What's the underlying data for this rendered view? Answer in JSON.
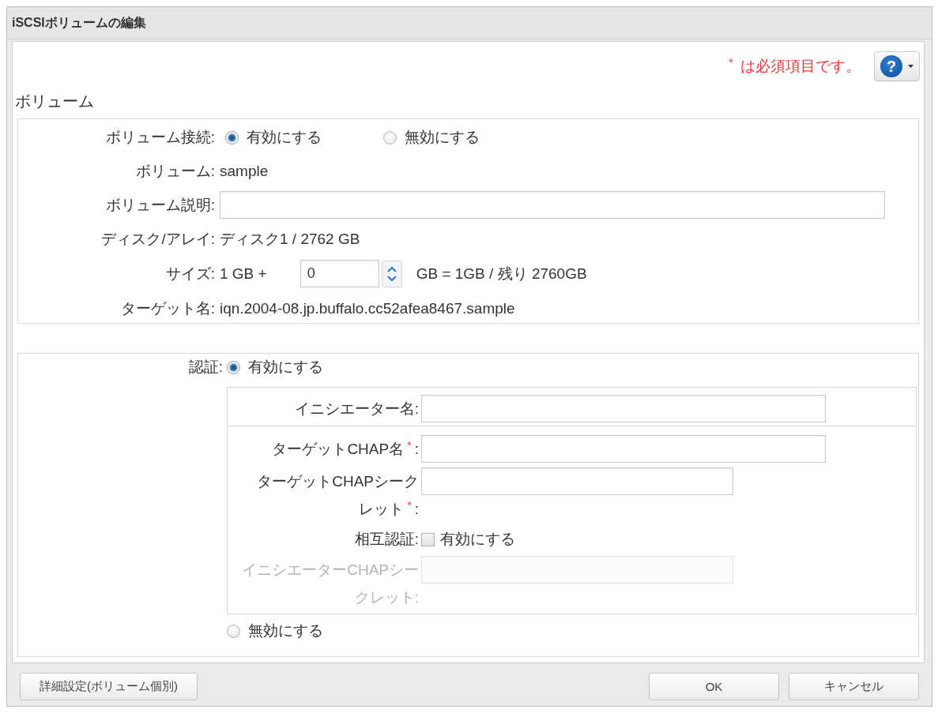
{
  "window": {
    "title": "iSCSIボリュームの編集"
  },
  "header": {
    "required_note": "$^{*}$ は必須項目です。",
    "help_button": {
      "symbol": "?"
    }
  },
  "volume": {
    "heading": "ボリューム",
    "rows": [
      {
        "kind": "radio",
        "label": "ボリューム接続:",
        "options": [
          {
            "label": "有効にする",
            "selected": true
          },
          {
            "label": "無効にする",
            "selected": false
          }
        ]
      },
      {
        "kind": "value",
        "label": "ボリューム:",
        "value": "sample"
      },
      {
        "kind": "input",
        "label": "ボリューム説明:"
      },
      {
        "kind": "value",
        "label": "ディスク/アレイ:",
        "value": "ディスク1 / 2762 GB"
      },
      {
        "kind": "size",
        "label": "サイズ:",
        "prefix": "1 GB +",
        "value": "0",
        "suffix": "GB = 1GB / 残り 2760GB"
      },
      {
        "kind": "value",
        "label": "ターゲット名:",
        "value": "iqn.2004-08.jp.buffalo.cc52afea8467.sample"
      }
    ]
  },
  "authentication": {
    "label": "認証:",
    "options": [
      {
        "label": "有効にする",
        "selected": true,
        "groups": [
          {
            "fields": [
              {
                "kind": "text",
                "label": "イニシエーター名:",
                "disabled": false
              }
            ]
          },
          {
            "fields": [
              {
                "kind": "text",
                "label": "ターゲットCHAP名$^{*}$:",
                "disabled": false
              },
              {
                "kind": "password",
                "label": "ターゲットCHAPシークレット$^{*}$:",
                "disabled": false
              },
              {
                "kind": "checkbox",
                "label": "相互認証:",
                "option": "有効にする",
                "checked": false,
                "disabled": false
              },
              {
                "kind": "password",
                "label": "イニシエーターCHAPシークレット:",
                "disabled": true
              }
            ]
          }
        ]
      },
      {
        "label": "無効にする",
        "selected": false
      }
    ]
  },
  "footer": {
    "advanced_button": "詳細設定(ボリューム個別)",
    "buttons": [
      "OK",
      "キャンセル"
    ]
  }
}
